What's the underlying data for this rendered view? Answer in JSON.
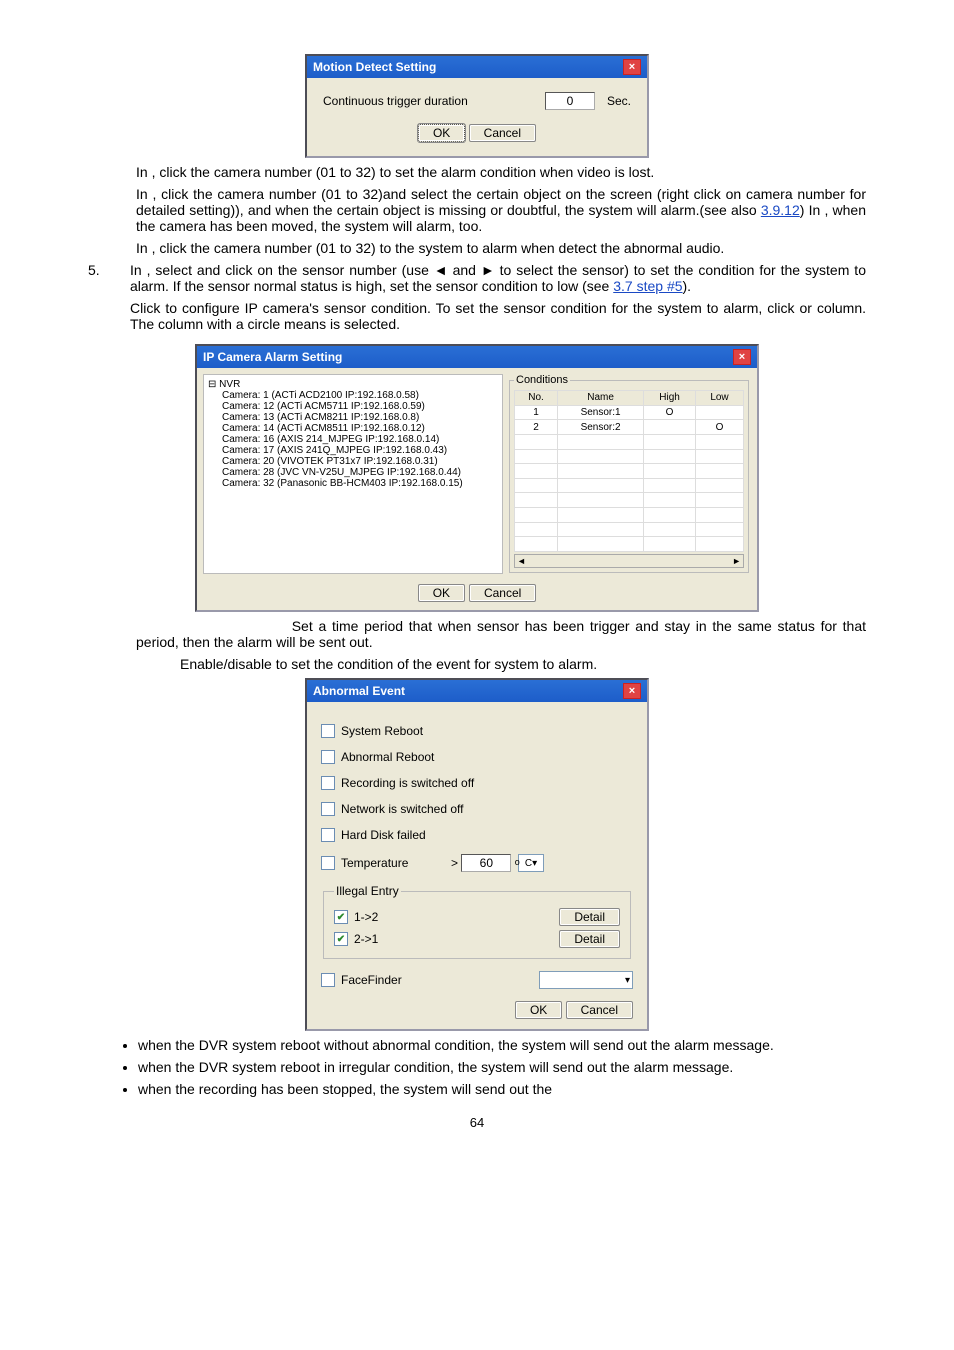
{
  "motion": {
    "title": "Motion Detect Setting",
    "label": "Continuous trigger duration",
    "value": "0",
    "unit": "Sec.",
    "ok": "OK",
    "cancel": "Cancel"
  },
  "t": {
    "p1_a": "In ",
    "p1_b": ", click the camera number (01 to 32) to set the alarm condition when video is lost.",
    "p2_a": "In ",
    "p2_b": ",  click  the  camera  number    (01  to  32)and  select  the certain object on the screen (right click on camera number for detailed setting)), and when the certain object  is  missing  or  doubtful,  the  system  will  alarm.(see  also ",
    "p2_link": "3.9.12",
    "p2_c": ")  In ",
    "p2_d": ",  when  the camera has been moved, the system will alarm, too.",
    "p3_a": "In ",
    "p3_b": ", click the camera number (01 to 32) to the system to alarm when detect the abnormal audio.",
    "n5": "5.",
    "p5_a": "In ",
    "p5_b": ",  select  and  click  on  the  sensor  number  (use  ◄  and  ►  to  select  the  sensor)  to  set  the condition for the system to alarm. If the sensor normal status is high, set the sensor condition to low (see ",
    "p5_link": "3.7 step #5",
    "p5_c": ").",
    "p6_a": "Click ",
    "p6_b": "  to  configure  IP  camera's  sensor  condition.  To  set  the  sensor  condition  for  the system to alarm, click ",
    "p6_or": " or ",
    "p6_c": " column. The column with a circle means is selected.",
    "p7": " Set a time period that when sensor has been trigger and stay in the same status for that period, then the alarm will be sent out.",
    "p8": " Enable/disable to set the condition of the event for system to alarm.",
    "b1": " when the DVR system reboot without abnormal condition, the system will send out the alarm message.",
    "b2": " when the DVR system reboot in irregular condition, the system will send out the alarm message.",
    "b3": "  when  the  recording  has  been  stopped,  the  system  will  send  out  the"
  },
  "ip": {
    "title": "IP Camera Alarm Setting",
    "root": "NVR",
    "cams": [
      "Camera: 1 (ACTi ACD2100 IP:192.168.0.58)",
      "Camera: 12 (ACTi ACM5711 IP:192.168.0.59)",
      "Camera: 13 (ACTi ACM8211 IP:192.168.0.8)",
      "Camera: 14 (ACTi ACM8511 IP:192.168.0.12)",
      "Camera: 16 (AXIS 214_MJPEG IP:192.168.0.14)",
      "Camera: 17 (AXIS 241Q_MJPEG IP:192.168.0.43)",
      "Camera: 20 (VIVOTEK PT31x7 IP:192.168.0.31)",
      "Camera: 28 (JVC VN-V25U_MJPEG IP:192.168.0.44)",
      "Camera: 32 (Panasonic BB-HCM403 IP:192.168.0.15)"
    ],
    "cond_leg": "Conditions",
    "h_no": "No.",
    "h_name": "Name",
    "h_high": "High",
    "h_low": "Low",
    "r1_no": "1",
    "r1_name": "Sensor:1",
    "r1_high": "O",
    "r1_low": "",
    "r2_no": "2",
    "r2_name": "Sensor:2",
    "r2_high": "",
    "r2_low": "O",
    "ok": "OK",
    "cancel": "Cancel"
  },
  "ab": {
    "title": "Abnormal Event",
    "items": {
      "sysreboot": "System Reboot",
      "abreboot": "Abnormal Reboot",
      "recoff": "Recording is switched off",
      "netoff": "Network is switched off",
      "hddfail": "Hard Disk failed",
      "temp": "Temperature",
      "gt": ">",
      "tempval": "60",
      "deg": "o",
      "cunit": "C",
      "fs_leg": "Illegal Entry",
      "e12": "1->2",
      "e21": "2->1",
      "detail": "Detail",
      "ff": "FaceFinder"
    },
    "ok": "OK",
    "cancel": "Cancel"
  },
  "page_num": "64"
}
